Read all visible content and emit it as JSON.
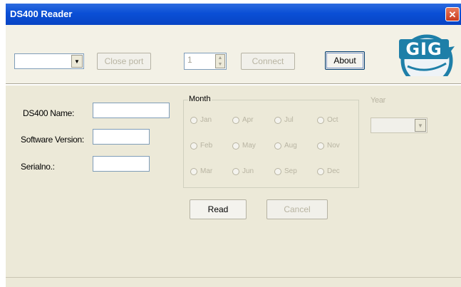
{
  "window": {
    "title": "DS400 Reader",
    "close_icon": "close-icon"
  },
  "toolbar": {
    "port_combo_value": "",
    "close_port_label": "Close port",
    "spin_value": "1",
    "connect_label": "Connect",
    "about_label": "About"
  },
  "logo": {
    "text": "GIG"
  },
  "fields": {
    "name_label": "DS400 Name:",
    "version_label": "Software Version:",
    "serial_label": "Serialno.:",
    "name_value": "",
    "version_value": "",
    "serial_value": ""
  },
  "month": {
    "title": "Month",
    "items": [
      "Jan",
      "Apr",
      "Jul",
      "Oct",
      "Feb",
      "May",
      "Aug",
      "Nov",
      "Mar",
      "Jun",
      "Sep",
      "Dec"
    ]
  },
  "year": {
    "label": "Year",
    "value": ""
  },
  "actions": {
    "read_label": "Read",
    "cancel_label": "Cancel"
  },
  "colors": {
    "title_bar": "#0a4fd6",
    "window_bg": "#ece9d8",
    "disabled_text": "#b8b4a2"
  }
}
